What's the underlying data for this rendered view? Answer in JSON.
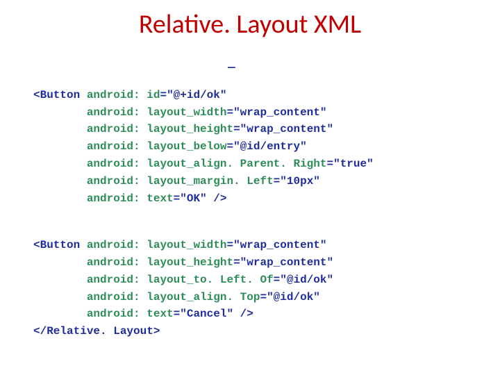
{
  "title": "Relative. Layout XML",
  "stray_underscore": "_",
  "code": {
    "b1_open_tag": "<Button",
    "b1_close_ind": "       ",
    "b1_close": "/>",
    "b2_open_tag": "<Button",
    "b2_close": "/>",
    "end_tag": "</Relative. Layout>",
    "attr_prefix": "android:",
    "attrs1": {
      "id_name": "id",
      "id_val": "\"@+id/ok\"",
      "lw_name": "layout_width",
      "lw_val": "\"wrap_content\"",
      "lh_name": "layout_height",
      "lh_val": "\"wrap_content\"",
      "lb_name": "layout_below",
      "lb_val": "\"@id/entry\"",
      "apr_name": "layout_align. Parent. Right",
      "apr_val": "\"true\"",
      "ml_name": "layout_margin. Left",
      "ml_val": "\"10px\"",
      "txt_name": "text",
      "txt_val": "\"OK\""
    },
    "attrs2": {
      "lw_name": "layout_width",
      "lw_val": "\"wrap_content\"",
      "lh_name": "layout_height",
      "lh_val": "\"wrap_content\"",
      "tlo_name": "layout_to. Left. Of",
      "tlo_val": "\"@id/ok\"",
      "at_name": "layout_align. Top",
      "at_val": "\"@id/ok\"",
      "txt_name": "text",
      "txt_val": "\"Cancel\""
    }
  }
}
